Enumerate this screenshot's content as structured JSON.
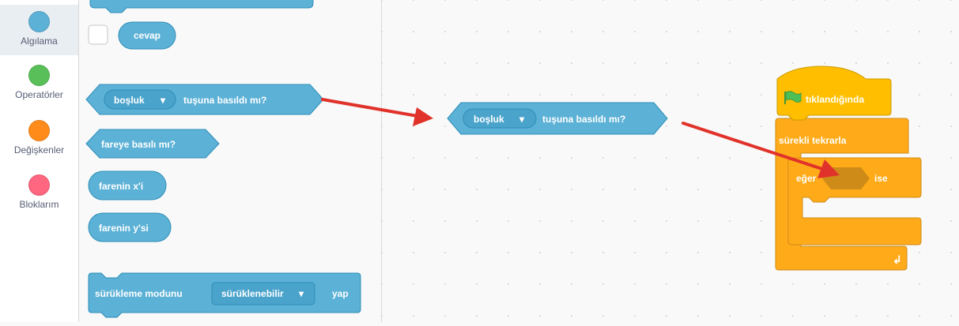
{
  "categories": [
    {
      "label": "Algılama",
      "color": "#5cb1d6",
      "selected": true
    },
    {
      "label": "Operatörler",
      "color": "#59c059"
    },
    {
      "label": "Değişkenler",
      "color": "#ff8c1a"
    },
    {
      "label": "Bloklarım",
      "color": "#ff6680"
    }
  ],
  "palette": {
    "answer_block": "cevap",
    "key_pressed": {
      "key": "boşluk",
      "text": "tuşuna basıldı mı?"
    },
    "mouse_down": "fareye basılı mı?",
    "mouse_x": "farenin x'i",
    "mouse_y": "farenin y'si",
    "drag_mode": {
      "text": "sürükleme modunu",
      "option": "sürüklenebilir",
      "suffix": "yap"
    }
  },
  "workspace": {
    "loose_block": {
      "key": "boşluk",
      "text": "tuşuna basıldı mı?"
    },
    "script": {
      "hat": "tıklandığında",
      "forever": "sürekli tekrarla",
      "if_left": "eğer",
      "if_right": "ise"
    }
  },
  "colors": {
    "sensing": "#5cb1d6",
    "sensing_dark": "#2e8eb8",
    "events": "#ffbf00",
    "control": "#ffab19",
    "control_dark": "#cf8b17",
    "arrow": "#e0322a"
  }
}
